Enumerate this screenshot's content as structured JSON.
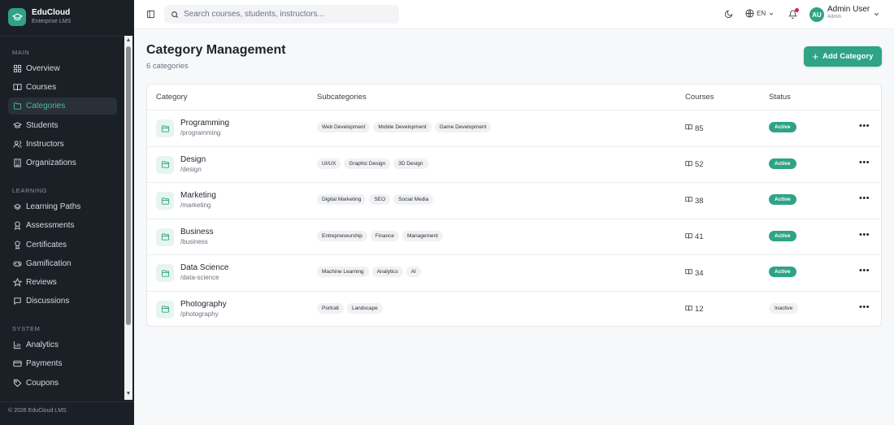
{
  "brand": {
    "name": "EduCloud",
    "subtitle": "Enterprise LMS"
  },
  "sidebar": {
    "sections": [
      {
        "title": "MAIN",
        "items": [
          {
            "label": "Overview",
            "icon": "grid-icon"
          },
          {
            "label": "Courses",
            "icon": "book-open-icon"
          },
          {
            "label": "Categories",
            "icon": "folder-icon",
            "active": true
          },
          {
            "label": "Students",
            "icon": "graduation-cap-icon"
          },
          {
            "label": "Instructors",
            "icon": "users-icon"
          },
          {
            "label": "Organizations",
            "icon": "building-icon"
          }
        ]
      },
      {
        "title": "LEARNING",
        "items": [
          {
            "label": "Learning Paths",
            "icon": "route-icon"
          },
          {
            "label": "Assessments",
            "icon": "award-icon"
          },
          {
            "label": "Certificates",
            "icon": "medal-icon"
          },
          {
            "label": "Gamification",
            "icon": "gamepad-icon"
          },
          {
            "label": "Reviews",
            "icon": "star-icon"
          },
          {
            "label": "Discussions",
            "icon": "message-icon"
          }
        ]
      },
      {
        "title": "SYSTEM",
        "items": [
          {
            "label": "Analytics",
            "icon": "bar-chart-icon"
          },
          {
            "label": "Payments",
            "icon": "credit-card-icon"
          },
          {
            "label": "Coupons",
            "icon": "tag-icon"
          }
        ]
      }
    ],
    "footer": "© 2026 EduCloud LMS"
  },
  "topbar": {
    "search_placeholder": "Search courses, students, instructors...",
    "language": "EN",
    "user": {
      "initials": "AU",
      "name": "Admin User",
      "role": "Admin"
    }
  },
  "page": {
    "title": "Category Management",
    "subtitle": "6 categories",
    "add_button": "Add Category"
  },
  "table": {
    "headers": {
      "category": "Category",
      "subcategories": "Subcategories",
      "courses": "Courses",
      "status": "Status"
    },
    "rows": [
      {
        "name": "Programming",
        "slug": "/programming",
        "subcategories": [
          "Web Development",
          "Mobile Development",
          "Game Development"
        ],
        "courses": "85",
        "status": "Active"
      },
      {
        "name": "Design",
        "slug": "/design",
        "subcategories": [
          "UI/UX",
          "Graphic Design",
          "3D Design"
        ],
        "courses": "52",
        "status": "Active"
      },
      {
        "name": "Marketing",
        "slug": "/marketing",
        "subcategories": [
          "Digital Marketing",
          "SEO",
          "Social Media"
        ],
        "courses": "38",
        "status": "Active"
      },
      {
        "name": "Business",
        "slug": "/business",
        "subcategories": [
          "Entrepreneurship",
          "Finance",
          "Management"
        ],
        "courses": "41",
        "status": "Active"
      },
      {
        "name": "Data Science",
        "slug": "/data-science",
        "subcategories": [
          "Machine Learning",
          "Analytics",
          "AI"
        ],
        "courses": "34",
        "status": "Active"
      },
      {
        "name": "Photography",
        "slug": "/photography",
        "subcategories": [
          "Portrait",
          "Landscape"
        ],
        "courses": "12",
        "status": "Inactive"
      }
    ]
  },
  "colors": {
    "accent": "#2fa386",
    "sidebar_bg": "#1b2027",
    "active_text": "#3cc29e",
    "notification": "#e11d48"
  }
}
